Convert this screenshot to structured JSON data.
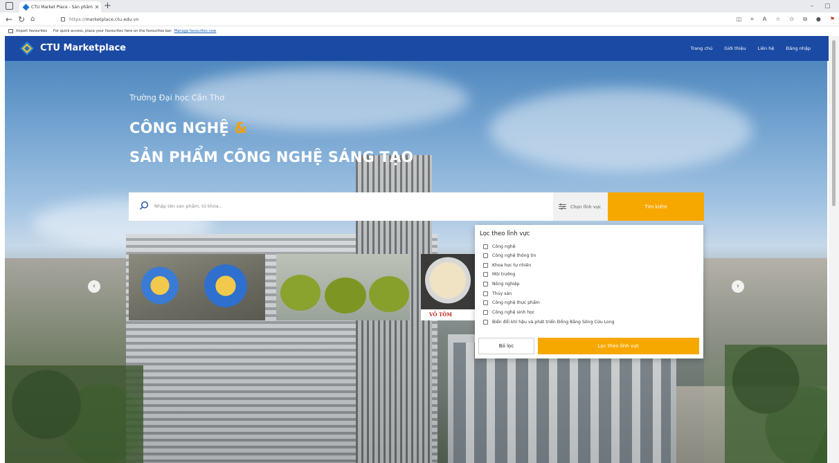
{
  "browser": {
    "tab_title": "CTU Market Place - Sản phẩm th",
    "tab_close": "✕",
    "new_tab": "+",
    "url_scheme": "https://",
    "url_host": "marketplace.ctu.edu.vn",
    "favbar_import": "Import favourites",
    "favbar_message": "For quick access, place your favourites here on the favourites bar.",
    "favbar_link": "Manage favourites now",
    "min": "–",
    "max": "▢"
  },
  "site": {
    "brand": "CTU Marketplace",
    "menu": [
      "Trang chủ",
      "Giới thiệu",
      "Liên hệ",
      "Đăng nhập"
    ],
    "accent_color": "#f7a800",
    "header_color": "#1a4aa3"
  },
  "hero": {
    "subtitle": "Trường Đại học Cần Thơ",
    "headline_1": "CÔNG NGHỆ",
    "headline_amp": "&",
    "headline_2": "SẢN PHẨM CÔNG NGHỆ SÁNG TẠO"
  },
  "search": {
    "placeholder": "Nhập tên sản phẩm, từ khóa...",
    "category_label": "Chọn lĩnh vực",
    "button": "Tìm kiếm"
  },
  "carousel": {
    "card3_label": "VỎ TÔM",
    "prev": "‹",
    "next": "›"
  },
  "filter": {
    "title": "Lọc theo lĩnh vực",
    "options": [
      "Công nghệ",
      "Công nghệ thông tin",
      "Khoa học tự nhiên",
      "Môi trường",
      "Nông nghiệp",
      "Thủy sản",
      "Công nghệ thực phẩm",
      "Công nghệ sinh học",
      "Biến đổi khí hậu và phát triển Đồng Bằng Sông Cửu Long"
    ],
    "reset": "Bỏ lọc",
    "apply": "Lọc theo lĩnh vực"
  }
}
